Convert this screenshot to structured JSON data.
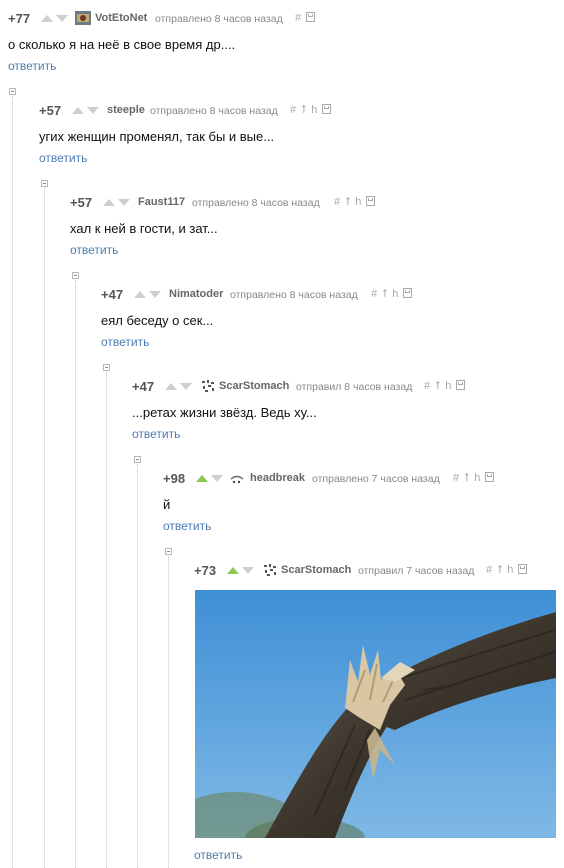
{
  "comments": [
    {
      "rating": "+77",
      "author": "VotEtoNet",
      "meta": "отправлено 8 часов назад",
      "text": "о сколько я на неё в свое время др....",
      "reply": "ответить"
    },
    {
      "rating": "+57",
      "author": "steeple",
      "meta": "отправлено 8 часов назад",
      "text": "угих женщин променял, так бы и вые...",
      "reply": "ответить"
    },
    {
      "rating": "+57",
      "author": "Faust117",
      "meta": "отправлено 8 часов назад",
      "text": "хал к ней в гости, и зат...",
      "reply": "ответить"
    },
    {
      "rating": "+47",
      "author": "Nimatoder",
      "meta": "отправлено 8 часов назад",
      "text": "еял беседу о сек...",
      "reply": "ответить"
    },
    {
      "rating": "+47",
      "author": "ScarStomach",
      "meta": "отправил 8 часов назад",
      "text": "...ретах жизни звёзд. Ведь ху...",
      "reply": "ответить"
    },
    {
      "rating": "+98",
      "author": "headbreak",
      "meta": "отправлено 7 часов назад",
      "text": "й",
      "reply": "ответить"
    },
    {
      "rating": "+73",
      "author": "ScarStomach",
      "meta": "отправил 7 часов назад",
      "text": "",
      "reply": "ответить"
    }
  ],
  "tools": {
    "hash": "#",
    "up": "⭡",
    "parent": "h"
  },
  "colors": {
    "link": "#4a7cb0",
    "upvote_active": "#8ac858",
    "vote_inactive": "#cfcfcf",
    "sky": "#5aa2dc",
    "bark": "#4a4338"
  },
  "image": {
    "subject": "broken-branch-photo"
  }
}
